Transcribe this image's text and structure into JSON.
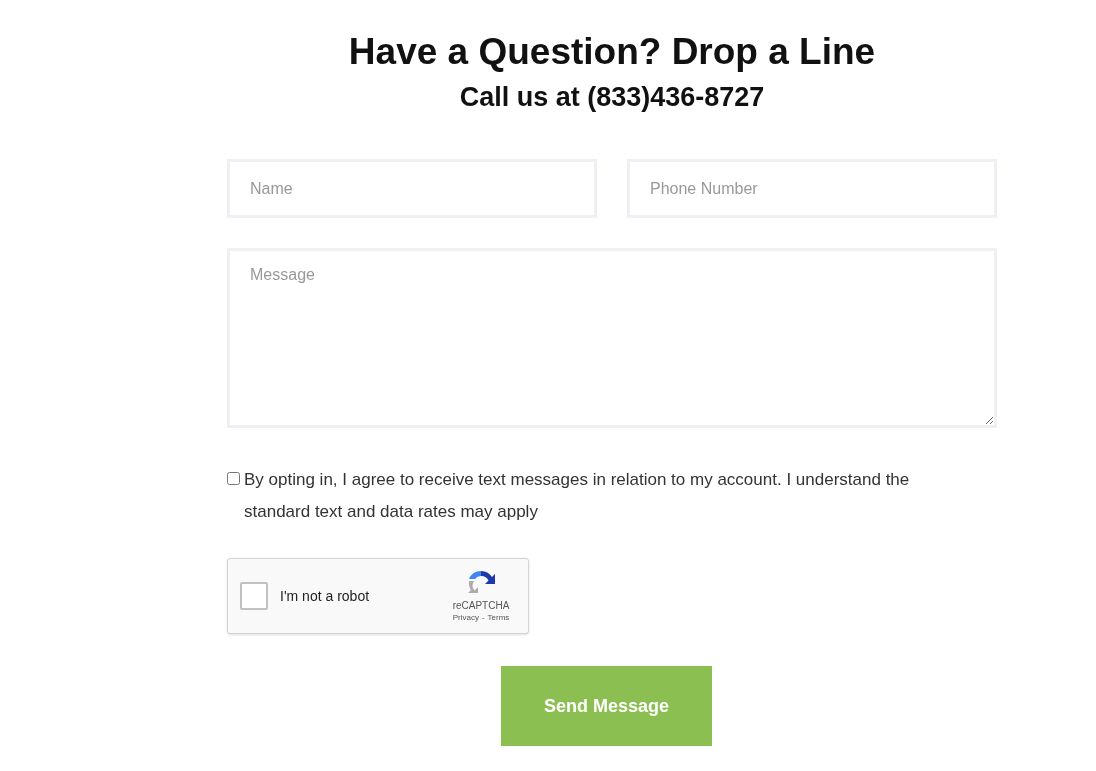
{
  "heading": "Have a Question? Drop a Line",
  "subheading": "Call us at (833)436-8727",
  "fields": [
    {
      "kind": "input",
      "placeholder": "Name"
    },
    {
      "kind": "input",
      "placeholder": "Phone Number"
    },
    {
      "kind": "textarea",
      "placeholder": "Message"
    }
  ],
  "consent": {
    "checked": false,
    "text": "By opting in, I agree to receive text messages in relation to my account. I understand the standard text and data rates may apply"
  },
  "captcha": {
    "checked": false,
    "label": "I'm not a robot",
    "brand": "reCAPTCHA",
    "privacy": "Privacy",
    "separator": "-",
    "terms": "Terms"
  },
  "submit": "Send Message"
}
